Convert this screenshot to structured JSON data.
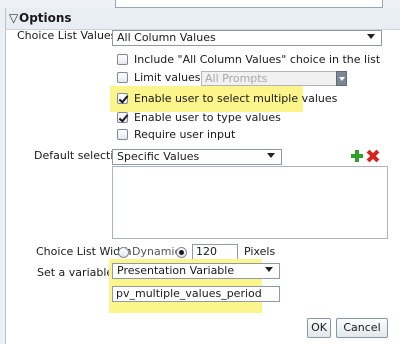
{
  "options": {
    "section_title": "Options",
    "toggle_glyph": "▽",
    "choice_list_values": {
      "label": "Choice List Values",
      "selected": "All Column Values"
    },
    "checkboxes": [
      {
        "label": "Include \"All Column Values\" choice in the list",
        "checked": false
      },
      {
        "label": "Limit values by",
        "checked": false,
        "dependent_select": "All Prompts"
      },
      {
        "label": "Enable user to select multiple values",
        "checked": true
      },
      {
        "label": "Enable user to type values",
        "checked": true
      },
      {
        "label": "Require user input",
        "checked": false
      }
    ],
    "default_selection": {
      "label": "Default selection",
      "selected": "Specific Values"
    },
    "choice_list_width": {
      "label": "Choice List Width",
      "dynamic_label": "Dynamic",
      "dynamic_selected": false,
      "fixed_selected": true,
      "width_value": "120",
      "unit": "Pixels"
    },
    "set_variable": {
      "label": "Set a variable",
      "selected": "Presentation Variable",
      "variable_name": "pv_multiple_values_period"
    }
  },
  "buttons": {
    "ok": "OK",
    "cancel": "Cancel"
  },
  "colors": {
    "highlight": "#fbf58c",
    "add": "#2fa12c",
    "delete": "#d6261e"
  }
}
